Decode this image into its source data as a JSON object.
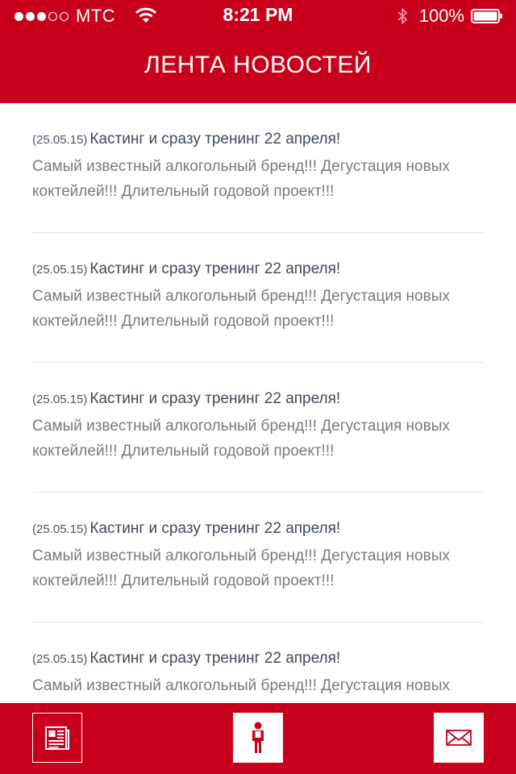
{
  "status_bar": {
    "carrier": "МТС",
    "time": "8:21 PM",
    "battery": "100%",
    "signal_bars_filled": 3,
    "signal_bars_total": 5
  },
  "header": {
    "title": "ЛЕНТА НОВОСТЕЙ"
  },
  "feed": {
    "items": [
      {
        "date": "(25.05.15)",
        "title": "Кастинг и сразу тренинг 22 апреля!",
        "body": "Самый известный алкогольный бренд!!! Дегустация новых коктейлей!!! Длительный годовой проект!!!"
      },
      {
        "date": "(25.05.15)",
        "title": "Кастинг и сразу тренинг 22 апреля!",
        "body": "Самый известный алкогольный бренд!!! Дегустация новых коктейлей!!! Длительный годовой проект!!!"
      },
      {
        "date": "(25.05.15)",
        "title": "Кастинг и сразу тренинг 22 апреля!",
        "body": "Самый известный алкогольный бренд!!! Дегустация новых коктейлей!!! Длительный годовой проект!!!"
      },
      {
        "date": "(25.05.15)",
        "title": "Кастинг и сразу тренинг 22 апреля!",
        "body": "Самый известный алкогольный бренд!!! Дегустация новых коктейлей!!! Длительный годовой проект!!!"
      },
      {
        "date": "(25.05.15)",
        "title": "Кастинг и сразу тренинг 22 апреля!",
        "body": "Самый известный алкогольный бренд!!! Дегустация новых коктейлей!!! Длительный годовой проект!!!"
      }
    ]
  },
  "tabbar": {
    "tabs": [
      {
        "icon": "newspaper-icon",
        "active": true
      },
      {
        "icon": "person-icon",
        "active": false
      },
      {
        "icon": "envelope-icon",
        "active": false
      }
    ]
  },
  "colors": {
    "brand_red": "#c8001b",
    "title_text": "#3f4a57",
    "body_text": "#7a7a7a",
    "divider": "#e4e4e4"
  }
}
